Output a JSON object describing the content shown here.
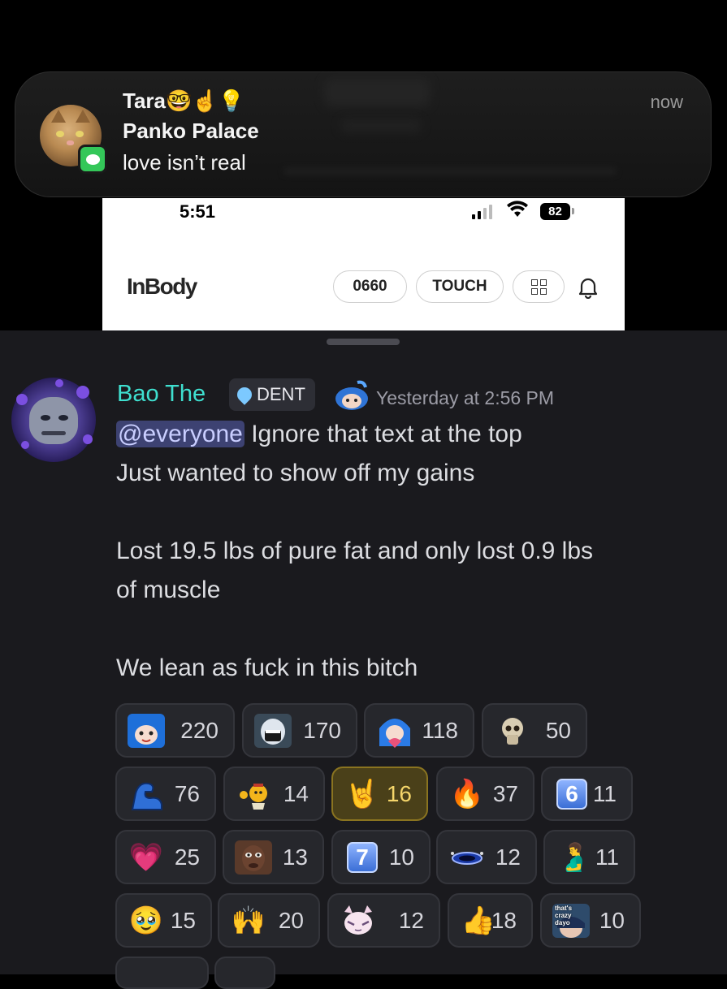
{
  "notification": {
    "title": "Tara🤓☝️💡",
    "subtitle": "Panko Palace",
    "body": "love isn’t real",
    "time": "now",
    "app_icon": "messages-icon"
  },
  "embedded_screenshot": {
    "status_time": "5:51",
    "battery": "82",
    "app_logo": "InBody",
    "pills": [
      "0660",
      "TOUCH"
    ],
    "icons": [
      "qr-code-icon",
      "bell-icon",
      "signal-icon",
      "wifi-icon"
    ]
  },
  "message": {
    "username": "Bao The",
    "username_color": "#3fe0d0",
    "role_tag": "DENT",
    "timestamp": "Yesterday at 2:56 PM",
    "mention": "@everyone",
    "line1_rest": " Ignore that text at the top",
    "line2": "Just wanted to show off my gains",
    "line3": "Lost 19.5 lbs of pure fat and only lost 0.9 lbs",
    "line4": "of muscle",
    "line5": "We lean as fuck in this bitch"
  },
  "reactions": [
    {
      "emoji": "custom-blue-hair-girl",
      "count": "220"
    },
    {
      "emoji": "custom-screaming-face",
      "count": "170"
    },
    {
      "emoji": "custom-blue-hair-heart",
      "count": "118"
    },
    {
      "emoji": "custom-skull",
      "count": "50"
    },
    {
      "emoji": "custom-blue-arm",
      "count": "76"
    },
    {
      "emoji": "custom-monkey-flex",
      "count": "14"
    },
    {
      "emoji": "🤘",
      "count": "16",
      "active": true
    },
    {
      "emoji": "🔥",
      "count": "37"
    },
    {
      "emoji": "6️⃣",
      "count": "11"
    },
    {
      "emoji": "💗",
      "count": "25"
    },
    {
      "emoji": "custom-face-photo",
      "count": "13"
    },
    {
      "emoji": "7️⃣",
      "count": "10"
    },
    {
      "emoji": "custom-portal",
      "count": "12"
    },
    {
      "emoji": "🫃",
      "count": "11"
    },
    {
      "emoji": "🥹",
      "count": "15"
    },
    {
      "emoji": "🙌",
      "count": "20"
    },
    {
      "emoji": "custom-anime-cat-girl",
      "count": "12"
    },
    {
      "emoji": "👍",
      "count": "18"
    },
    {
      "emoji": "custom-thats-crazy-dayo",
      "count": "10",
      "caption": "that's crazy dayo"
    }
  ],
  "colors": {
    "background": "#1a1a1e",
    "reaction_bg": "#26272c",
    "reaction_active_bg": "#4a4019",
    "mention_bg": "#3d4272"
  }
}
